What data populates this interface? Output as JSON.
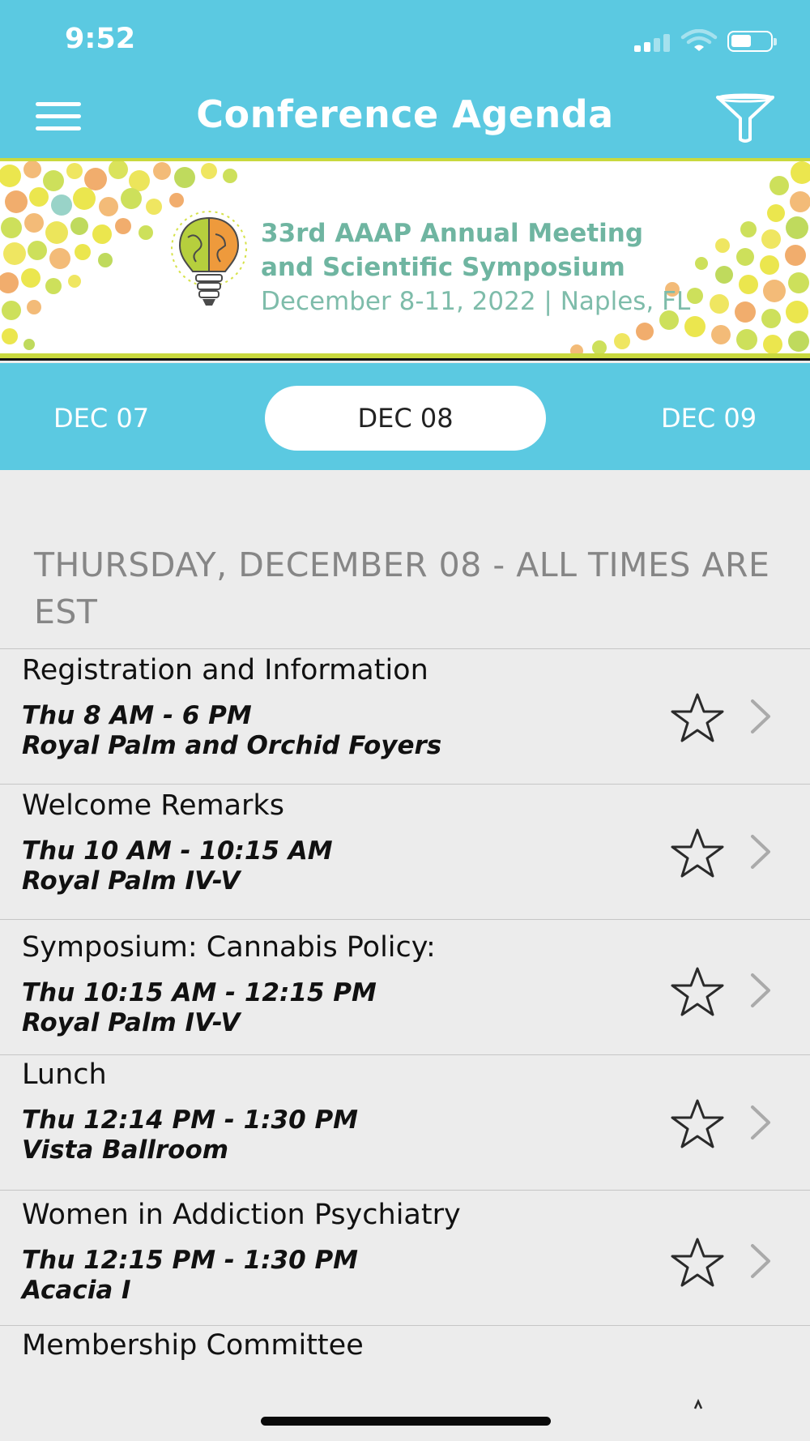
{
  "status": {
    "time": "9:52"
  },
  "nav": {
    "title": "Conference Agenda"
  },
  "banner": {
    "line1": "33rd AAAP Annual Meeting",
    "line2": "and Scientific Symposium",
    "line3": "December 8-11, 2022 | Naples, FL"
  },
  "dates": {
    "prev": "DEC 07",
    "selected": "DEC 08",
    "next": "DEC 09"
  },
  "section_header": "THURSDAY, DECEMBER 08 - ALL TIMES ARE EST",
  "sessions": [
    {
      "title": "Registration and Information",
      "time": "Thu 8 AM - 6 PM",
      "room": "Royal Palm and Orchid Foyers"
    },
    {
      "title": "Welcome Remarks",
      "time": "Thu 10 AM - 10:15 AM",
      "room": "Royal Palm IV-V"
    },
    {
      "title": "Symposium: Cannabis Policy:",
      "time": "Thu 10:15 AM - 12:15 PM",
      "room": "Royal Palm IV-V"
    },
    {
      "title": "Lunch",
      "time": "Thu 12:14 PM - 1:30 PM",
      "room": "Vista Ballroom"
    },
    {
      "title": "Women in Addiction Psychiatry",
      "time": "Thu 12:15 PM - 1:30 PM",
      "room": "Acacia I"
    },
    {
      "title": "Membership Committee"
    }
  ],
  "icons": {
    "menu": "hamburger-menu-icon",
    "filter": "funnel-filter-icon",
    "favorite": "star-outline-icon",
    "detail": "chevron-right-icon"
  },
  "colors": {
    "header_bg": "#5bc9e1",
    "list_bg": "#ececec",
    "banner_text": "#6fb5a1"
  }
}
